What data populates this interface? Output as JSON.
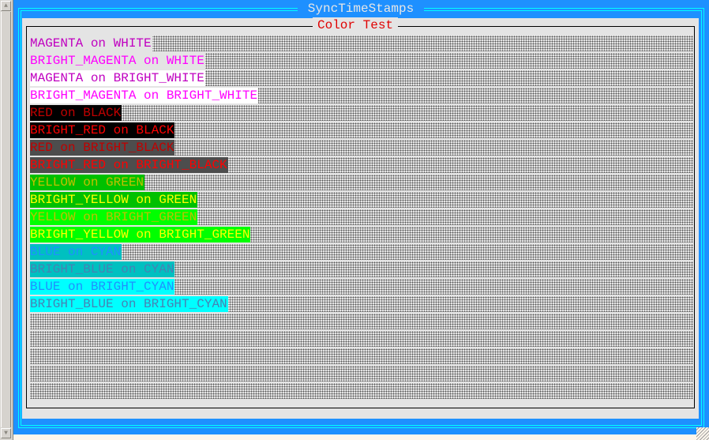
{
  "window": {
    "title": "SyncTimeStamps"
  },
  "panel": {
    "title": "Color Test"
  },
  "colors": {
    "frame": "#1e90ff",
    "frame_line": "#00ffff",
    "panel_bg": "#e4e4e4",
    "title_text": "#e00000"
  },
  "rows": [
    {
      "label": "MAGENTA on WHITE",
      "fg": "#c000c0",
      "bg": "#e4e4e4"
    },
    {
      "label": "BRIGHT_MAGENTA on WHITE",
      "fg": "#ff00ff",
      "bg": "#e4e4e4"
    },
    {
      "label": "MAGENTA on BRIGHT_WHITE",
      "fg": "#c000c0",
      "bg": "#ffffff"
    },
    {
      "label": "BRIGHT_MAGENTA on BRIGHT_WHITE",
      "fg": "#ff00ff",
      "bg": "#ffffff"
    },
    {
      "label": "RED on BLACK",
      "fg": "#c00000",
      "bg": "#000000"
    },
    {
      "label": "BRIGHT_RED on BLACK",
      "fg": "#ff0000",
      "bg": "#000000"
    },
    {
      "label": "RED on BRIGHT_BLACK",
      "fg": "#c00000",
      "bg": "#4d4d4d"
    },
    {
      "label": "BRIGHT_RED on BRIGHT_BLACK",
      "fg": "#ff0000",
      "bg": "#4d4d4d"
    },
    {
      "label": "YELLOW on GREEN",
      "fg": "#c0c000",
      "bg": "#00c000"
    },
    {
      "label": "BRIGHT_YELLOW on GREEN",
      "fg": "#ffff00",
      "bg": "#00c000"
    },
    {
      "label": "YELLOW on BRIGHT_GREEN",
      "fg": "#c0c000",
      "bg": "#00ff00"
    },
    {
      "label": "BRIGHT_YELLOW on BRIGHT_GREEN",
      "fg": "#ffff00",
      "bg": "#00ff00"
    },
    {
      "label": "BLUE on CYAN",
      "fg": "#1e90ff",
      "bg": "#00c0c0"
    },
    {
      "label": "BRIGHT_BLUE on CYAN",
      "fg": "#4682b4",
      "bg": "#00c0c0"
    },
    {
      "label": "BLUE on BRIGHT_CYAN",
      "fg": "#1e90ff",
      "bg": "#00ffff"
    },
    {
      "label": "BRIGHT_BLUE on BRIGHT_CYAN",
      "fg": "#4682b4",
      "bg": "#00ffff"
    }
  ],
  "empty_rows": 5
}
